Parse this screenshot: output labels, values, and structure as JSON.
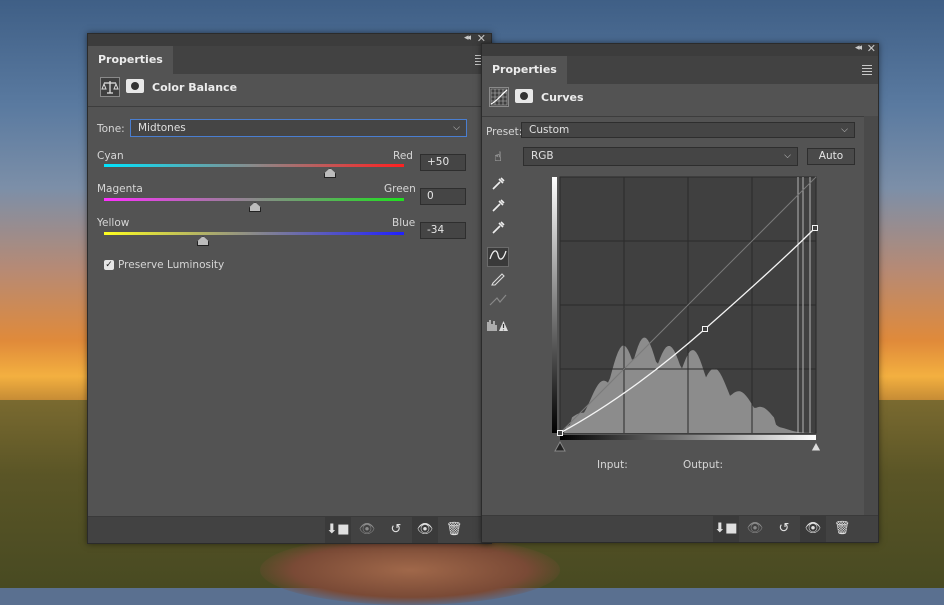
{
  "colorBalance": {
    "tab_label": "Properties",
    "title": "Color Balance",
    "tone_label": "Tone:",
    "tone_value": "Midtones",
    "sliders": [
      {
        "left": "Cyan",
        "right": "Red",
        "value": "+50"
      },
      {
        "left": "Magenta",
        "right": "Green",
        "value": "0"
      },
      {
        "left": "Yellow",
        "right": "Blue",
        "value": "-34"
      }
    ],
    "preserve_luminosity": "Preserve Luminosity"
  },
  "curves": {
    "tab_label": "Properties",
    "title": "Curves",
    "preset_label": "Preset:",
    "preset_value": "Custom",
    "channel_value": "RGB",
    "auto_label": "Auto",
    "input_label": "Input:",
    "output_label": "Output:",
    "points": [
      [
        0,
        0
      ],
      [
        145,
        104
      ],
      [
        255,
        205
      ]
    ]
  },
  "colors": {
    "panel_bg": "#535353",
    "focus_border": "#4a7ed0"
  }
}
